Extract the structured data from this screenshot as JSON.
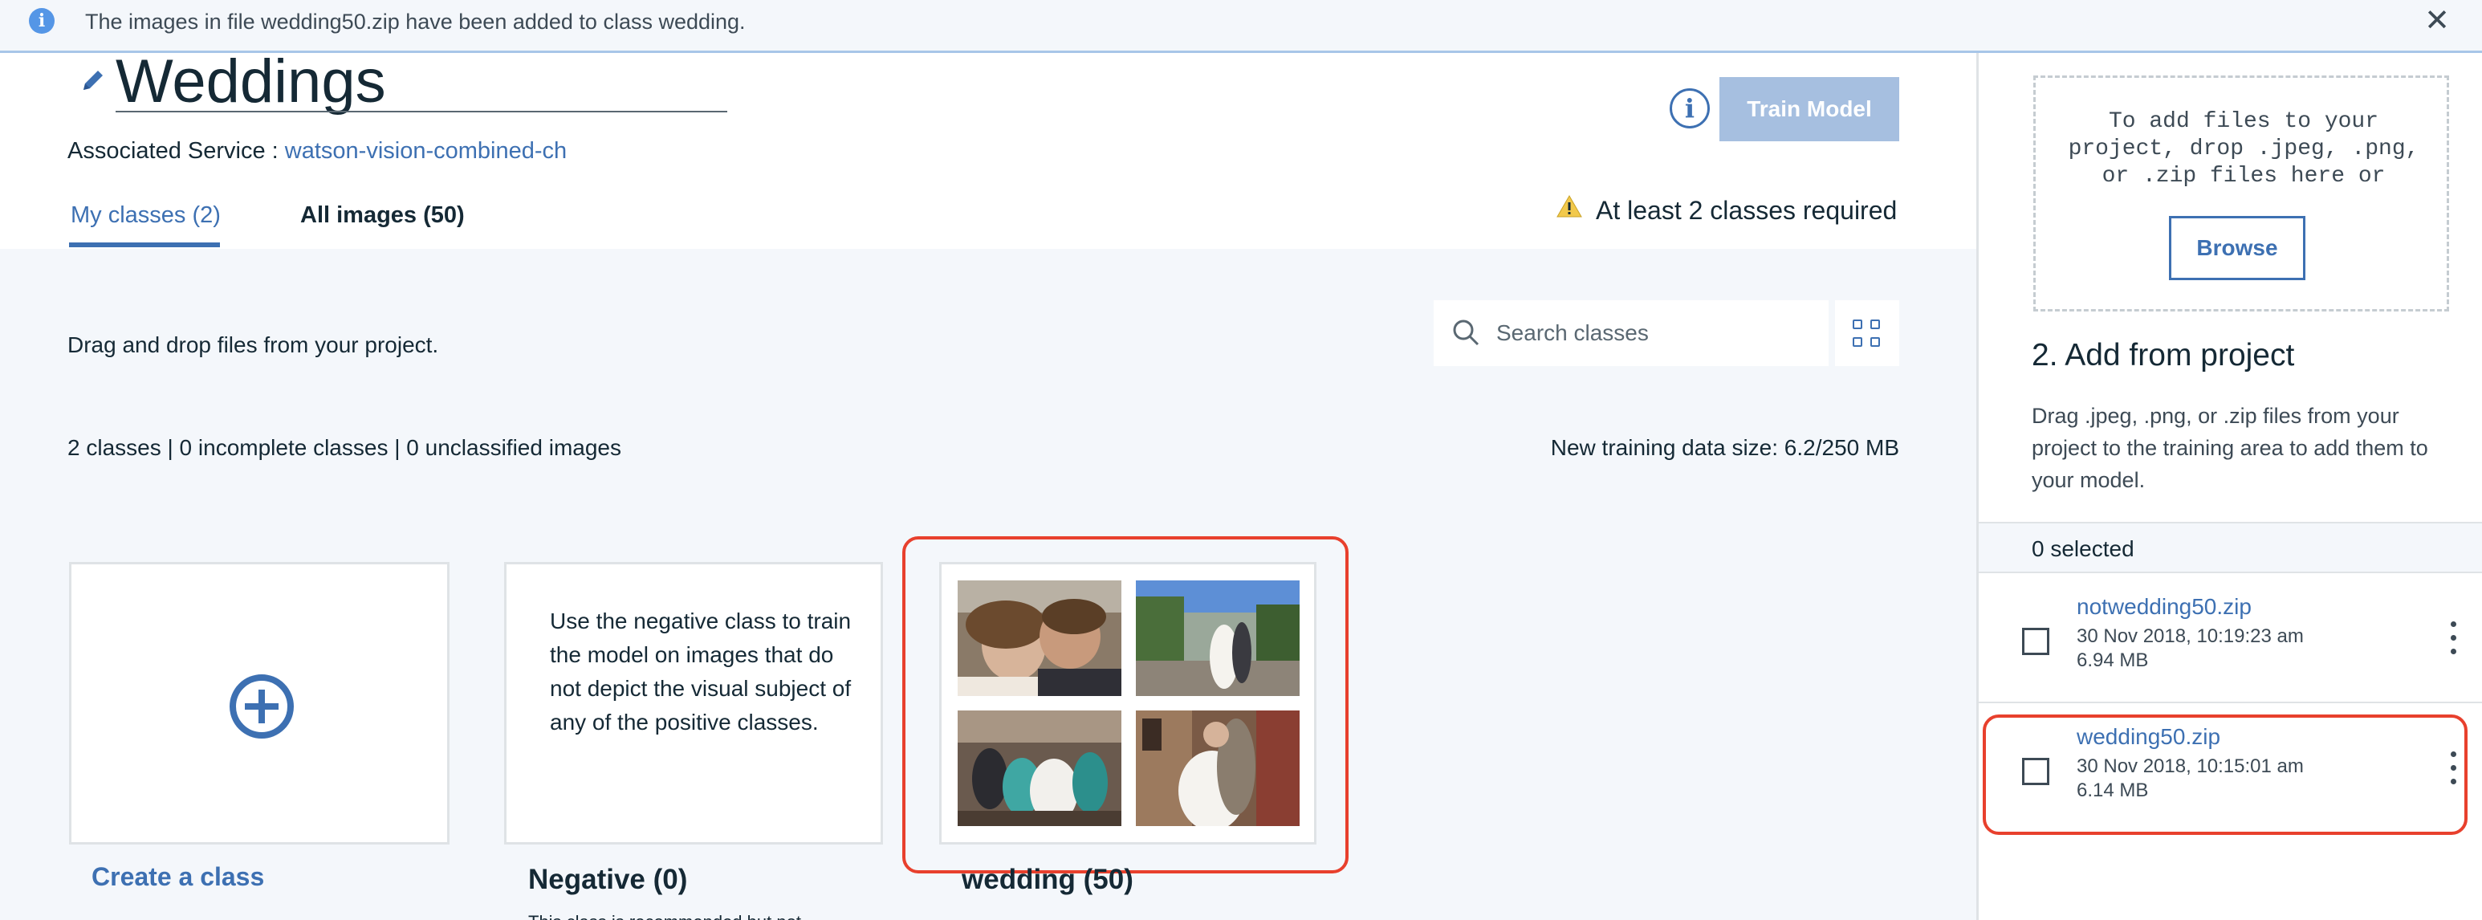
{
  "notification": {
    "message": "The images in file wedding50.zip have been added to class wedding.",
    "close": "✕"
  },
  "header": {
    "title": "Weddings",
    "assoc_label": "Associated Service : ",
    "assoc_link": "watson-vision-combined-ch",
    "info_glyph": "i",
    "train_button": "Train Model",
    "warning": "At least 2 classes required"
  },
  "tabs": [
    {
      "label": "My classes (2)",
      "active": true
    },
    {
      "label": "All images (50)",
      "active": false
    }
  ],
  "content": {
    "drag_hint": "Drag and drop files from your project.",
    "search_placeholder": "Search classes",
    "stats": "2 classes | 0 incomplete classes | 0 unclassified images",
    "training_size": "New training data size: 6.2/250 MB"
  },
  "classes": {
    "create_label": "Create a class",
    "negative": {
      "description": "Use the negative class to train the model on images that do not depict the visual subject of any of the positive classes.",
      "title": "Negative (0)",
      "note": "This class is recommended but not required."
    },
    "wedding": {
      "title": "wedding (50)"
    }
  },
  "right_panel": {
    "drop_text": "To add files to your project, drop .jpeg, .png, or .zip files here or",
    "browse": "Browse",
    "add_title": "2. Add from project",
    "add_desc": "Drag .jpeg, .png, or .zip files from your project to the training area to add them to your model.",
    "selected": "0 selected",
    "files": [
      {
        "name": "notwedding50.zip",
        "date": "30 Nov 2018, 10:19:23 am",
        "size": "6.94 MB"
      },
      {
        "name": "wedding50.zip",
        "date": "30 Nov 2018, 10:15:01 am",
        "size": "6.14 MB"
      }
    ]
  },
  "colors": {
    "accent": "#3d70b2",
    "highlight": "#e8402d",
    "disabled_button": "#a6bfe0",
    "warning": "#f2c94c"
  },
  "icons": [
    "info-icon",
    "close-icon",
    "pencil-icon",
    "info-circle-icon",
    "warning-icon",
    "search-icon",
    "grid-view-icon",
    "add-circle-icon",
    "checkbox-icon",
    "overflow-menu-icon"
  ]
}
